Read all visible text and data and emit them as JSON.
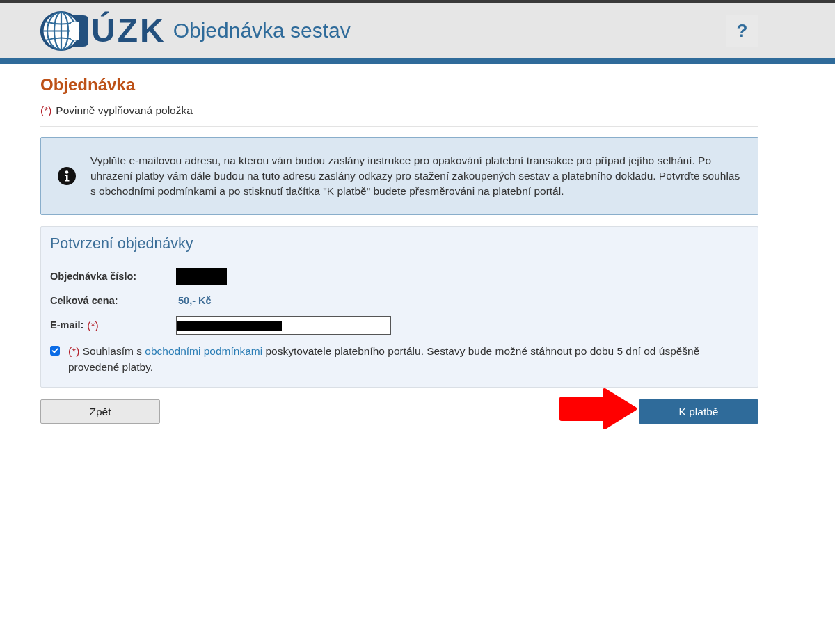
{
  "header": {
    "logo_text": "ÚZK",
    "title": "Objednávka sestav",
    "help_button": "?"
  },
  "page": {
    "heading": "Objednávka",
    "required_note": {
      "mark": "(*)",
      "text": "Povinně vyplňovaná položka"
    }
  },
  "info_box": {
    "text": "Vyplňte e-mailovou adresu, na kterou vám budou zaslány instrukce pro opakování platební transakce pro případ jejího selhání. Po uhrazení platby vám dále budou na tuto adresu zaslány odkazy pro stažení zakoupených sestav a platebního dokladu. Potvrďte souhlas s obchodními podmínkami a po stisknutí tlačítka \"K platbě\" budete přesměrováni na platební portál."
  },
  "confirmation": {
    "title": "Potvrzení objednávky",
    "fields": [
      {
        "kind": "redacted",
        "label": "Objednávka číslo:"
      },
      {
        "kind": "text",
        "label": "Celková cena:",
        "value": "50,- Kč"
      },
      {
        "kind": "input",
        "label": "E-mail:",
        "required_mark": "(*)",
        "redacted": true
      }
    ],
    "consent": {
      "checked": true,
      "required_mark": "(*)",
      "text_before": "Souhlasím s",
      "link": "obchodními podmínkami",
      "text_after": "poskytovatele platebního portálu. Sestavy bude možné stáhnout po dobu 5 dní od úspěšně provedené platby."
    }
  },
  "buttons": [
    {
      "kind": "secondary",
      "label": "Zpět"
    },
    {
      "kind": "primary",
      "label": "K platbě"
    }
  ]
}
